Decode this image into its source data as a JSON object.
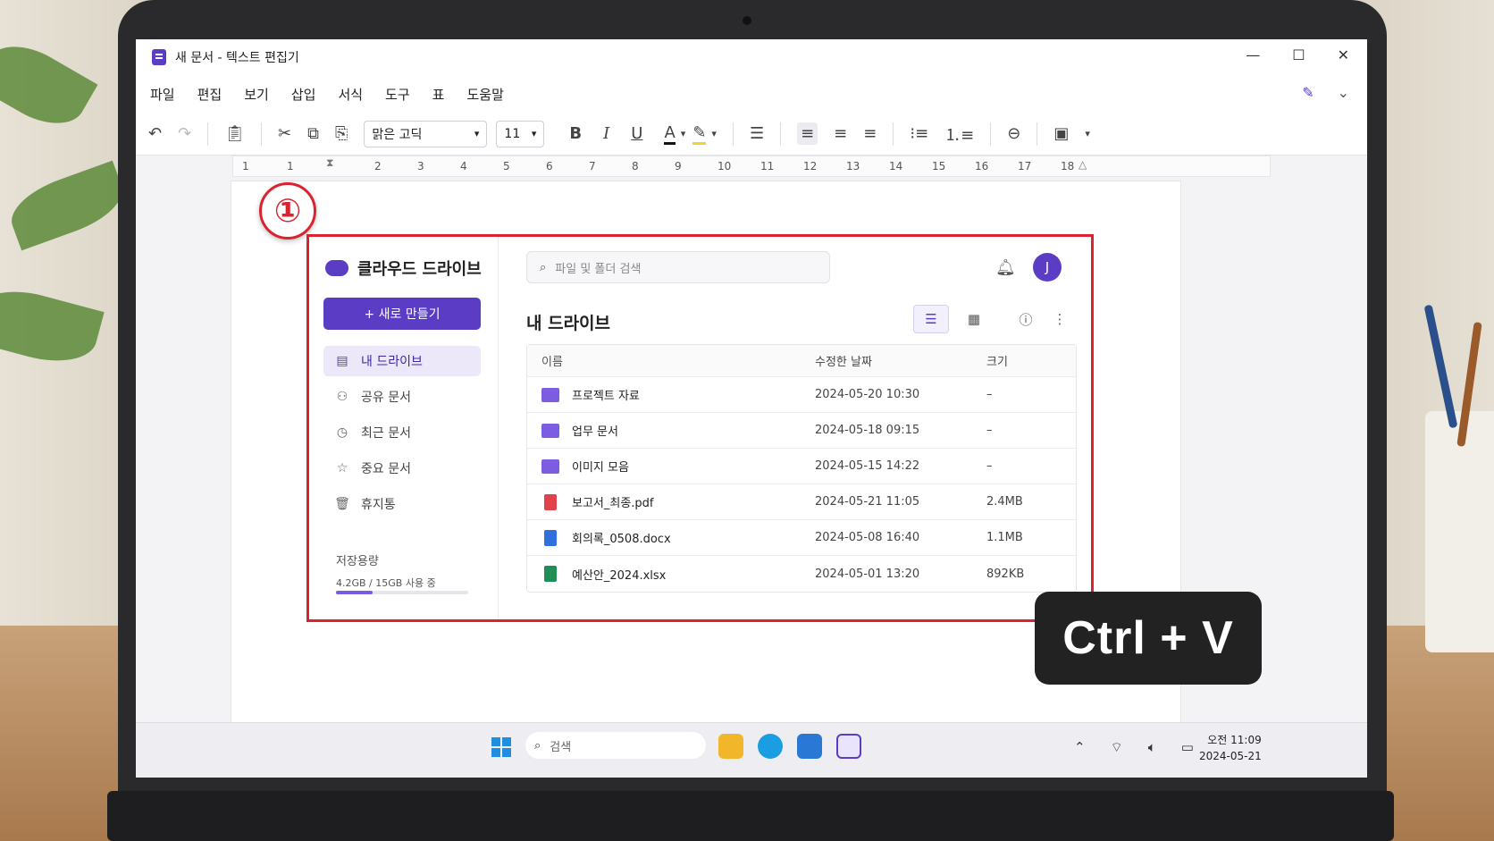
{
  "window": {
    "title": "새 문서 - 텍스트 편집기",
    "minimize": "—",
    "maximize": "☐",
    "close": "✕"
  },
  "menu": [
    "파일",
    "편집",
    "보기",
    "삽입",
    "서식",
    "도구",
    "표",
    "도움말"
  ],
  "toolbar": {
    "font": "맑은 고딕",
    "size": "11",
    "bold": "B",
    "italic": "I",
    "underline": "U",
    "color_letter": "A"
  },
  "ruler": [
    "1",
    "1",
    "2",
    "3",
    "4",
    "5",
    "6",
    "7",
    "8",
    "9",
    "10",
    "11",
    "12",
    "13",
    "14",
    "15",
    "16",
    "17",
    "18"
  ],
  "step_badge": "①",
  "drive": {
    "brand": "클라우드 드라이브",
    "new_button": "+ 새로 만들기",
    "nav": [
      {
        "label": "내 드라이브",
        "icon": "document-icon",
        "active": true
      },
      {
        "label": "공유 문서",
        "icon": "people-icon"
      },
      {
        "label": "최근 문서",
        "icon": "clock-icon"
      },
      {
        "label": "중요 문서",
        "icon": "star-icon"
      },
      {
        "label": "휴지통",
        "icon": "trash-icon"
      }
    ],
    "storage_label": "저장용량",
    "storage_text": "4.2GB / 15GB 사용 중",
    "storage_used_fraction": 0.28,
    "search_placeholder": "파일 및 폴더 검색",
    "avatar_letter": "J",
    "heading": "내 드라이브",
    "columns": [
      "이름",
      "수정한 날짜",
      "크기"
    ],
    "files": [
      {
        "name": "프로젝트 자료",
        "date": "2024-05-20 10:30",
        "size": "–",
        "type": "folder"
      },
      {
        "name": "업무 문서",
        "date": "2024-05-18 09:15",
        "size": "–",
        "type": "folder"
      },
      {
        "name": "이미지 모음",
        "date": "2024-05-15 14:22",
        "size": "–",
        "type": "folder"
      },
      {
        "name": "보고서_최종.pdf",
        "date": "2024-05-21 11:05",
        "size": "2.4MB",
        "type": "pdf"
      },
      {
        "name": "회의록_0508.docx",
        "date": "2024-05-08 16:40",
        "size": "1.1MB",
        "type": "word"
      },
      {
        "name": "예산안_2024.xlsx",
        "date": "2024-05-01 13:20",
        "size": "892KB",
        "type": "excel"
      }
    ]
  },
  "shortcut": "Ctrl + V",
  "taskbar": {
    "search": "검색",
    "time_period": "오전 11:09",
    "date": "2024-05-21"
  },
  "colors": {
    "accent": "#5b3cc4",
    "highlight_frame": "#d9232e"
  }
}
